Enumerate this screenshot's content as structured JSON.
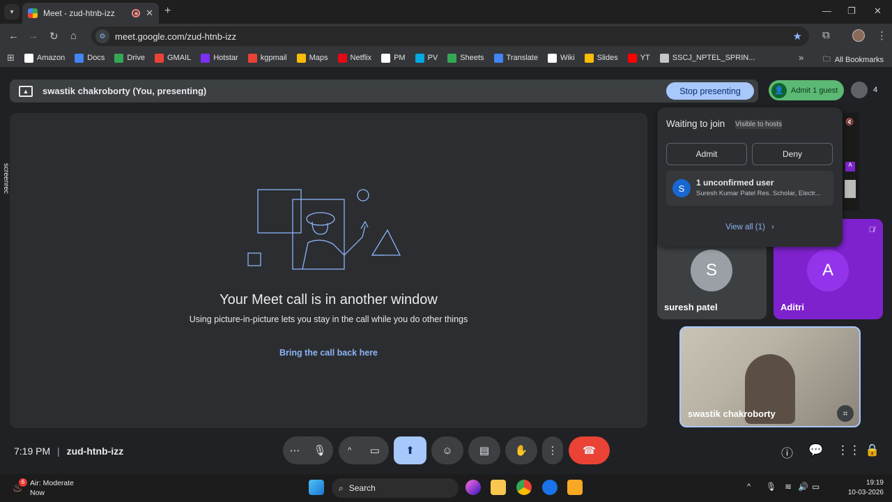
{
  "browser": {
    "tab_title": "Meet - zud-htnb-izz",
    "tab_close": "✕",
    "new_tab": "+",
    "url": "meet.google.com/zud-htnb-izz",
    "bookmarks": [
      {
        "label": "Amazon",
        "color": "#ffffff"
      },
      {
        "label": "Docs",
        "color": "#4285f4"
      },
      {
        "label": "Drive",
        "color": "#34a853"
      },
      {
        "label": "GMAIL",
        "color": "#ea4335"
      },
      {
        "label": "Hotstar",
        "color": "#7b2ff7"
      },
      {
        "label": "kgpmail",
        "color": "#ea4335"
      },
      {
        "label": "Maps",
        "color": "#fbbc04"
      },
      {
        "label": "Netflix",
        "color": "#e50914"
      },
      {
        "label": "PM",
        "color": "#ffffff"
      },
      {
        "label": "PV",
        "color": "#00a8e1"
      },
      {
        "label": "Sheets",
        "color": "#34a853"
      },
      {
        "label": "Translate",
        "color": "#4285f4"
      },
      {
        "label": "Wiki",
        "color": "#ffffff"
      },
      {
        "label": "Slides",
        "color": "#fbbc04"
      },
      {
        "label": "YT",
        "color": "#ff0000"
      },
      {
        "label": "SSCJ_NPTEL_SPRIN...",
        "color": "#c4c7c5"
      }
    ],
    "all_bookmarks": "All Bookmarks",
    "more": "»"
  },
  "meet": {
    "presenter": "swastik chakroborty (You, presenting)",
    "stop_presenting": "Stop presenting",
    "admit_guest": "Admit 1 guest",
    "people_count": "4",
    "stage": {
      "title": "Your Meet call is in another window",
      "subtitle": "Using picture-in-picture lets you stay in the call while you do other things",
      "link": "Bring the call back here"
    },
    "waiting": {
      "title": "Waiting to join",
      "badge": "Visible to hosts",
      "admit": "Admit",
      "deny": "Deny",
      "user_initial": "S",
      "user_title": "1 unconfirmed user",
      "user_detail": "Suresh Kumar Patel Res. Scholar, Electr...",
      "view_all": "View all (1)"
    },
    "tiles": [
      {
        "name": "suresh patel",
        "initial": "S"
      },
      {
        "name": "Aditri",
        "initial": "A"
      },
      {
        "name": "swastik chakroborty"
      }
    ],
    "screenrec": "screenrec",
    "time": "7:19 PM",
    "meeting_code": "zud-htnb-izz"
  },
  "taskbar": {
    "weather_title": "Air: Moderate",
    "weather_sub": "Now",
    "weather_badge": "6",
    "search": "Search",
    "clock_time": "19:19",
    "clock_date": "10-03-2026"
  },
  "colors": {
    "end_call": "#ea4335",
    "present_active": "#a8c7fa",
    "admit_green": "#5bb974"
  }
}
